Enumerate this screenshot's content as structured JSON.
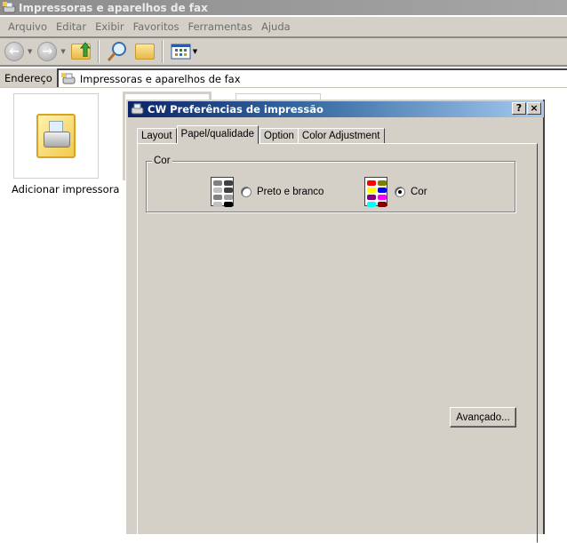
{
  "explorer": {
    "title": "Impressoras e aparelhos de fax",
    "menu": [
      "Arquivo",
      "Editar",
      "Exibir",
      "Favoritos",
      "Ferramentas",
      "Ajuda"
    ],
    "toolbar": {
      "icons": [
        "back-arrow-icon",
        "forward-arrow-icon",
        "up-folder-icon",
        "search-icon",
        "folders-icon",
        "views-icon"
      ],
      "back_glyph": "←",
      "forward_glyph": "→",
      "dropdown_glyph": "▼"
    },
    "address": {
      "label": "Endereço",
      "value": "Impressoras e aparelhos de fax"
    },
    "items": [
      {
        "label": "Adicionar impressora",
        "icon": "add-printer-icon"
      }
    ]
  },
  "dialog": {
    "title": "CW Preferências de impressão",
    "help_glyph": "?",
    "close_glyph": "×",
    "tabs": [
      {
        "label": "Layout",
        "active": false
      },
      {
        "label": "Papel/qualidade",
        "active": true
      },
      {
        "label": "Option",
        "active": false
      },
      {
        "label": "Color Adjustment",
        "active": false
      }
    ],
    "color_group": {
      "legend": "Cor",
      "options": [
        {
          "label": "Preto e branco",
          "checked": false,
          "icon": "grayscale-document-icon",
          "swatches": [
            "#808080",
            "#404040",
            "#c0c0c0",
            "#404040",
            "#808080",
            "#a0a0a0",
            "#c0c0c0",
            "#000000"
          ]
        },
        {
          "label": "Cor",
          "checked": true,
          "icon": "color-document-icon",
          "swatches": [
            "#ff0000",
            "#808000",
            "#ffff00",
            "#0000ff",
            "#800080",
            "#ff00ff",
            "#00ffff",
            "#800000"
          ]
        }
      ]
    },
    "advanced_button": "Avançado..."
  }
}
